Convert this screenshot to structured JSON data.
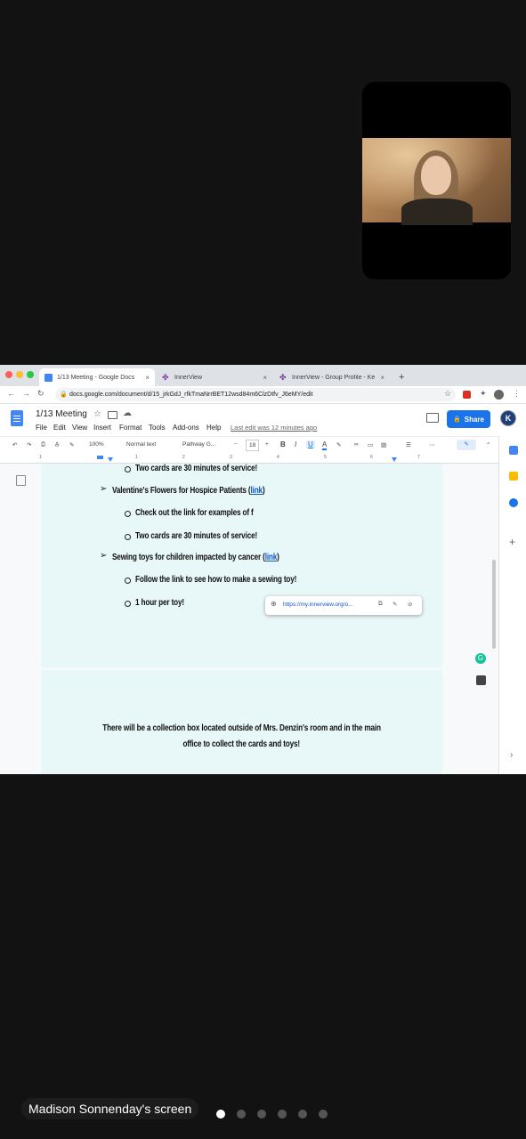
{
  "browser": {
    "tabs": [
      {
        "title": "1/13 Meeting - Google Docs",
        "close": "×"
      },
      {
        "title": "InnerView",
        "close": "×"
      },
      {
        "title": "InnerView - Group Profile - Ke",
        "close": "×"
      }
    ],
    "new_tab": "+",
    "url": "docs.google.com/document/d/15_jrkGdJ_rfkTmaNrrBET12wsd84m6ClzDtfv_J6eMY/edit"
  },
  "docs": {
    "title": "1/13 Meeting",
    "menu": [
      "File",
      "Edit",
      "View",
      "Insert",
      "Format",
      "Tools",
      "Add-ons",
      "Help"
    ],
    "last_edit": "Last edit was 12 minutes ago",
    "share_label": "Share",
    "avatar_letter": "K",
    "toolbar": {
      "zoom": "100%",
      "style": "Normal text",
      "font": "Pathway G...",
      "font_size": "18",
      "bold": "B",
      "italic": "I",
      "underline": "U",
      "text_color": "A"
    },
    "ruler_numbers": [
      "1",
      "1",
      "2",
      "3",
      "4",
      "5",
      "6",
      "7"
    ],
    "content": {
      "line1": "Two cards are 30 minutes of service!",
      "bullet2": "Valentine's Flowers for Hospice Patients (",
      "bullet2_link": "link",
      "bullet2_end": ")",
      "line3": "Check out the link for examples of f",
      "line4": "Two cards are 30 minutes of service!",
      "bullet5": "Sewing toys for children impacted by cancer (",
      "bullet5_link": "link",
      "bullet5_end": ")",
      "line6": "Follow the link to see how to make a sewing toy!",
      "line7": "1 hour per toy!",
      "footer_line1": "There will be a collection box located outside of Mrs. Denzin's room and in the main",
      "footer_line2": "office to collect the cards and toys!"
    },
    "link_popup_url": "https://my.innerview.org/o..."
  },
  "caption": "Madison Sonnenday's screen",
  "pagination": {
    "count": 6,
    "active_index": 0
  },
  "colors": {
    "share_blue": "#1a73e8",
    "page_bg": "#e8f7f8",
    "link": "#1155cc"
  }
}
